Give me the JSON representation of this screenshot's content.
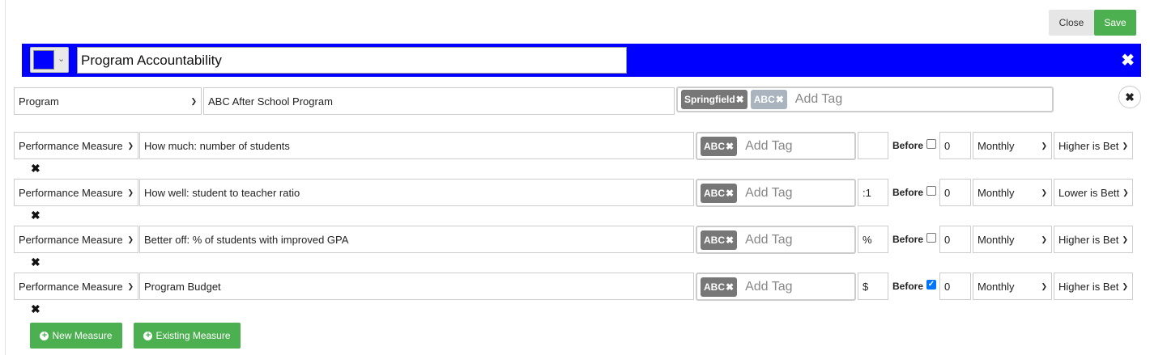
{
  "toolbar": {
    "close_label": "Close",
    "save_label": "Save"
  },
  "header": {
    "color": "#0000ff",
    "title": "Program Accountability"
  },
  "program": {
    "type": "Program",
    "name": "ABC After School Program",
    "tags": [
      "Springfield",
      "ABC"
    ],
    "tag_placeholder": "Add Tag"
  },
  "measures": [
    {
      "type": "Performance Measure",
      "name": "How much: number of students",
      "tag": "ABC",
      "tag_placeholder": "Add Tag",
      "unit": "",
      "before_label": "Before",
      "before_checked": false,
      "decimals": "0",
      "frequency": "Monthly",
      "direction": "Higher is Bet"
    },
    {
      "type": "Performance Measure",
      "name": "How well: student to teacher ratio",
      "tag": "ABC",
      "tag_placeholder": "Add Tag",
      "unit": ":1",
      "before_label": "Before",
      "before_checked": false,
      "decimals": "0",
      "frequency": "Monthly",
      "direction": "Lower is Bett"
    },
    {
      "type": "Performance Measure",
      "name": "Better off: % of students with improved GPA",
      "tag": "ABC",
      "tag_placeholder": "Add Tag",
      "unit": "%",
      "before_label": "Before",
      "before_checked": false,
      "decimals": "0",
      "frequency": "Monthly",
      "direction": "Higher is Bet"
    },
    {
      "type": "Performance Measure",
      "name": "Program Budget",
      "tag": "ABC",
      "tag_placeholder": "Add Tag",
      "unit": "$",
      "before_label": "Before",
      "before_checked": true,
      "decimals": "0",
      "frequency": "Monthly",
      "direction": "Higher is Bet"
    }
  ],
  "actions": {
    "new_measure": "New Measure",
    "existing_measure": "Existing Measure"
  },
  "colors": {
    "accent_green": "#4caf50",
    "header_blue": "#0000ff",
    "tag_dark": "#777777",
    "tag_light": "#a9b4be"
  }
}
